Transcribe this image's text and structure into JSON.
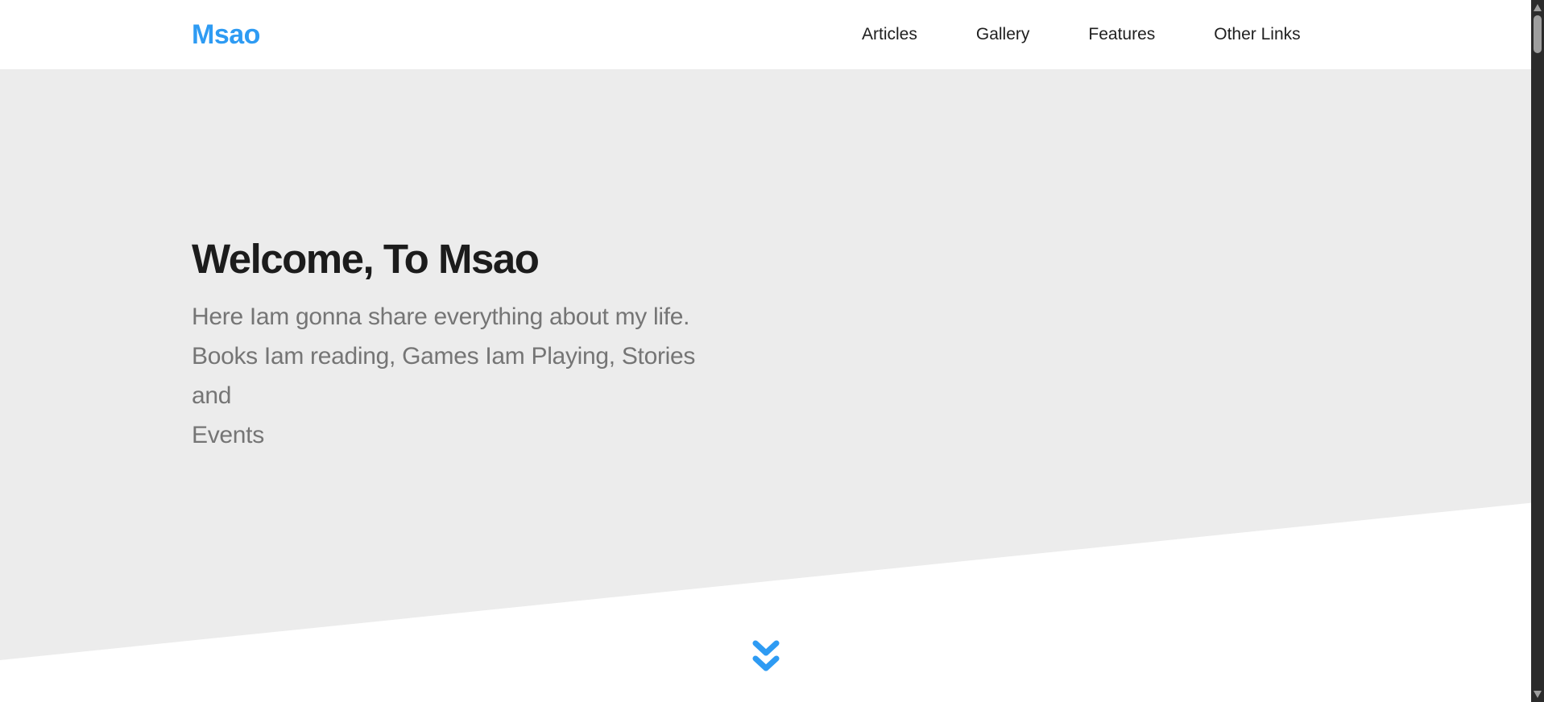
{
  "brand": {
    "name": "Msao"
  },
  "nav": {
    "items": [
      {
        "label": "Articles"
      },
      {
        "label": "Gallery"
      },
      {
        "label": "Features"
      },
      {
        "label": "Other Links"
      }
    ]
  },
  "hero": {
    "title": "Welcome, To Msao",
    "subtitle_lines": [
      "Here Iam gonna share everything about my life.",
      "Books Iam reading, Games Iam Playing, Stories and",
      "Events"
    ]
  },
  "icons": {
    "scroll_down": "double-chevron-down-icon",
    "scrollbar_up": "arrow-up-icon",
    "scrollbar_down": "arrow-down-icon"
  },
  "colors": {
    "accent_blue": "#2e9bf3",
    "hero_background": "#ececec",
    "heading_text": "#1c1c1c",
    "body_text": "#757575",
    "scrollbar_track": "#2b2b2b",
    "scrollbar_thumb": "#9e9e9e"
  }
}
